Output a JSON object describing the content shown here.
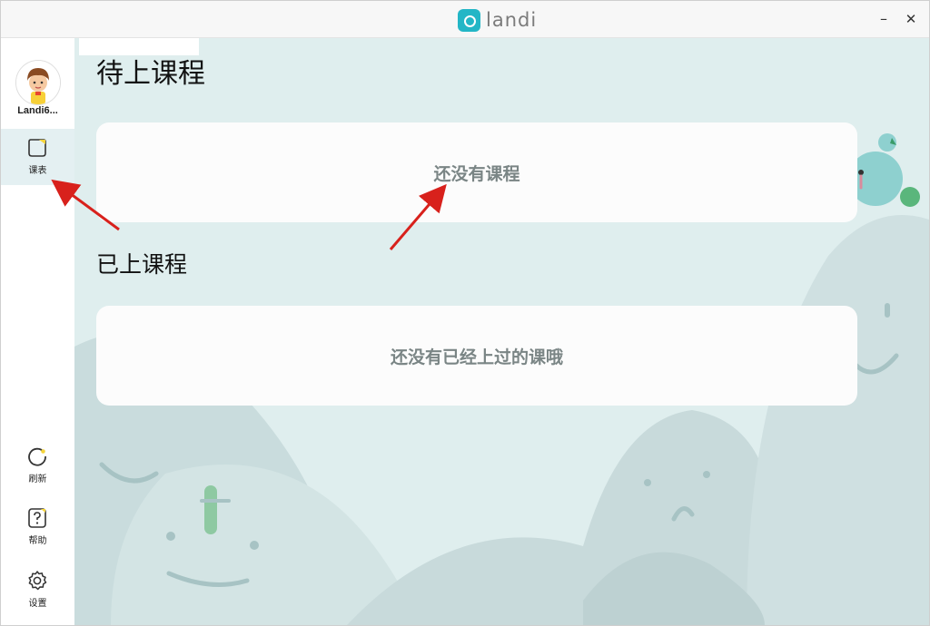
{
  "app": {
    "brand": "landi"
  },
  "titlebar": {
    "minimize_glyph": "–",
    "close_glyph": "✕"
  },
  "user": {
    "name": "Landi6..."
  },
  "sidebar": {
    "items": [
      {
        "label": "课表",
        "icon": "schedule-icon",
        "active": true
      },
      {
        "label": "刷新",
        "icon": "refresh-icon",
        "active": false
      },
      {
        "label": "帮助",
        "icon": "help-icon",
        "active": false
      },
      {
        "label": "设置",
        "icon": "settings-icon",
        "active": false
      }
    ]
  },
  "main": {
    "upcoming": {
      "title": "待上课程",
      "empty_text": "还没有课程"
    },
    "completed": {
      "title": "已上课程",
      "empty_text": "还没有已经上过的课哦"
    }
  },
  "colors": {
    "brand": "#23b6c6",
    "background": "#dfeeee",
    "annotation_arrow": "#d8211c"
  }
}
